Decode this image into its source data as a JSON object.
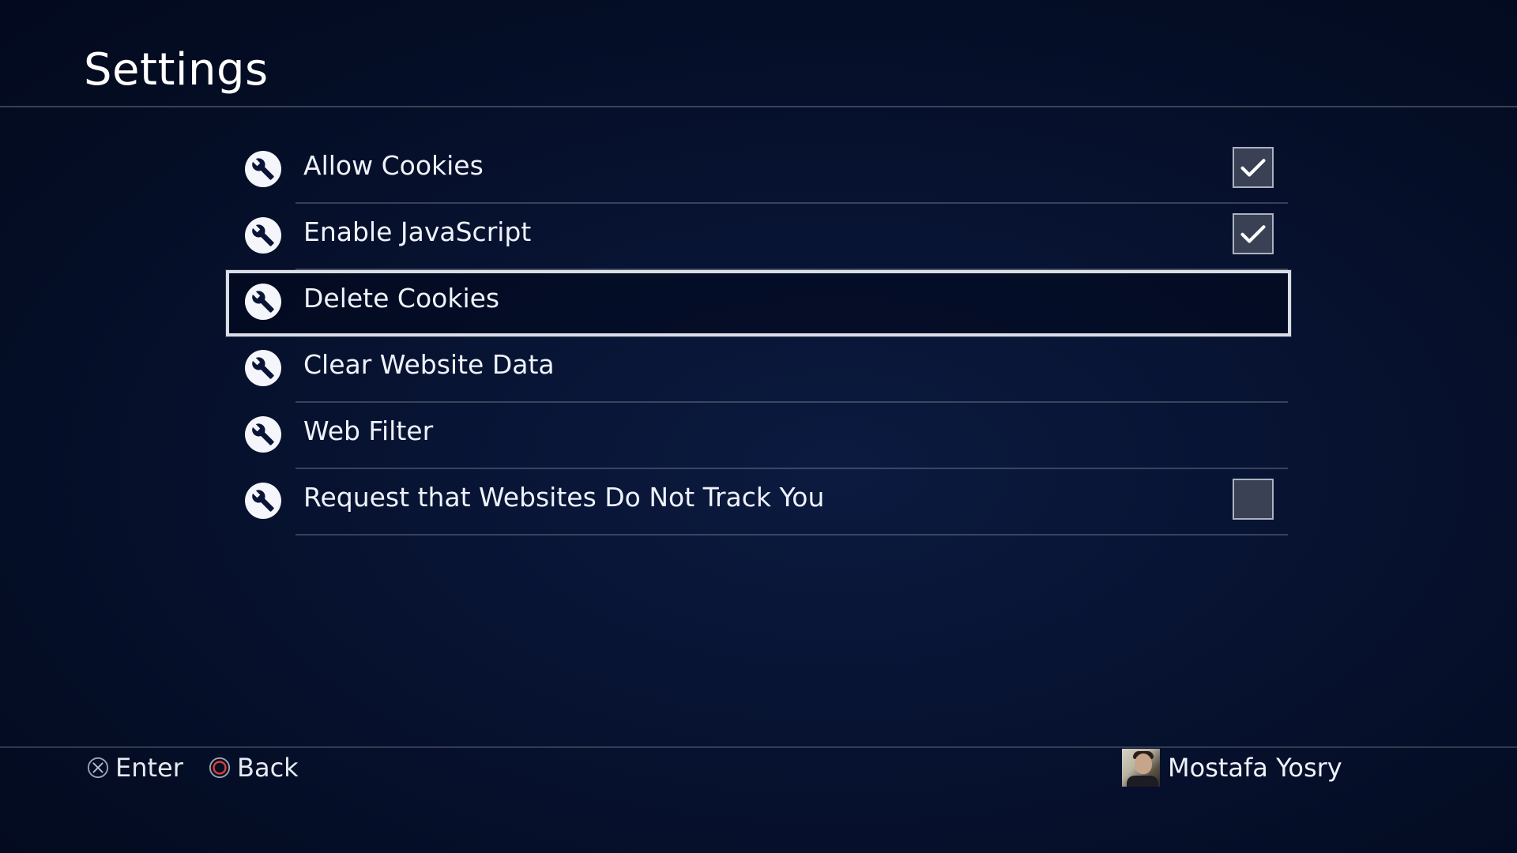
{
  "header": {
    "title": "Settings"
  },
  "settings": {
    "items": [
      {
        "label": "Allow Cookies",
        "icon": "wrench-icon",
        "has_checkbox": true,
        "checked": true,
        "focused": false
      },
      {
        "label": "Enable JavaScript",
        "icon": "wrench-icon",
        "has_checkbox": true,
        "checked": true,
        "focused": false
      },
      {
        "label": "Delete Cookies",
        "icon": "wrench-icon",
        "has_checkbox": false,
        "checked": false,
        "focused": true
      },
      {
        "label": "Clear Website Data",
        "icon": "wrench-icon",
        "has_checkbox": false,
        "checked": false,
        "focused": false
      },
      {
        "label": "Web Filter",
        "icon": "wrench-icon",
        "has_checkbox": false,
        "checked": false,
        "focused": false
      },
      {
        "label": "Request that Websites Do Not Track You",
        "icon": "wrench-icon",
        "has_checkbox": true,
        "checked": false,
        "focused": false
      }
    ]
  },
  "footer": {
    "enter_label": "Enter",
    "enter_icon": "cross-button-icon",
    "back_label": "Back",
    "back_icon": "circle-button-icon",
    "user_name": "Mostafa Yosry",
    "avatar_icon": "user-avatar"
  },
  "colors": {
    "background": "#061230",
    "circle_button": "#e0412e",
    "focus_outline": "#d9dde6"
  }
}
